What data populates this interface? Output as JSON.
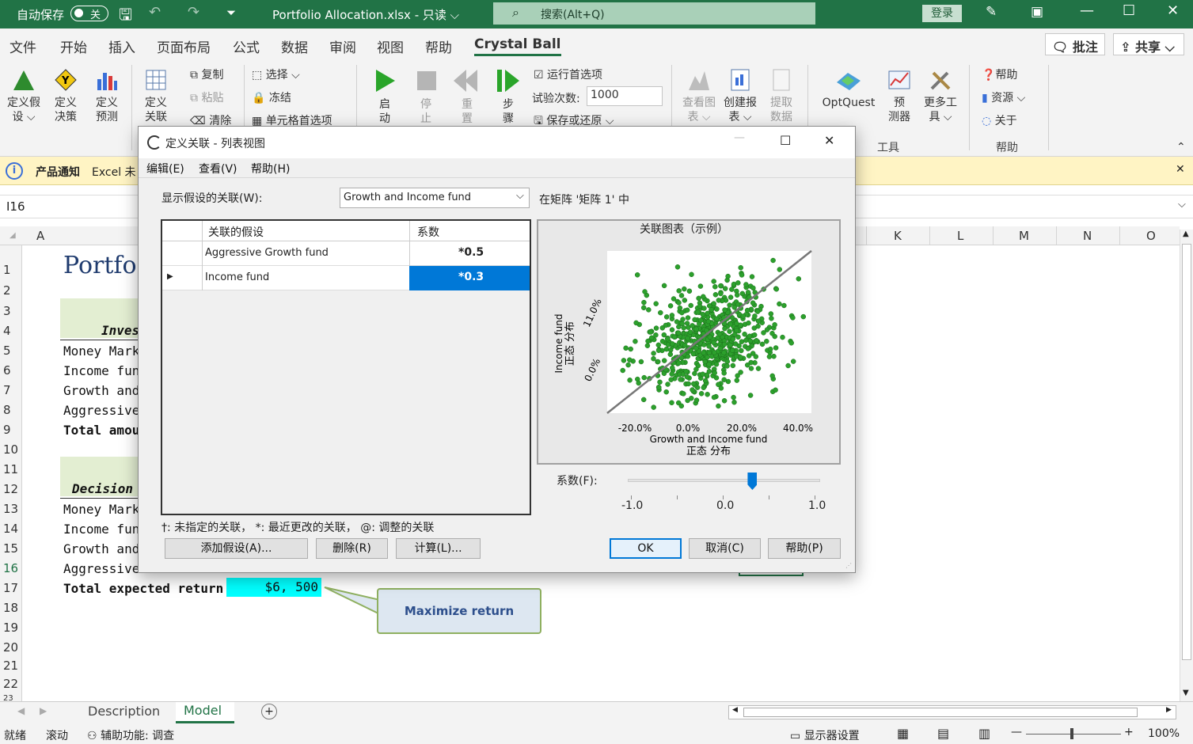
{
  "titlebar": {
    "autosave_label": "自动保存",
    "autosave_state": "关",
    "filename": "Portfolio Allocation.xlsx - 只读 ⌵",
    "search_placeholder": "搜索(Alt+Q)",
    "login": "登录"
  },
  "menu": {
    "tabs": [
      "文件",
      "开始",
      "插入",
      "页面布局",
      "公式",
      "数据",
      "审阅",
      "视图",
      "帮助",
      "Crystal Ball"
    ],
    "comments": "批注",
    "share": "共享"
  },
  "ribbon": {
    "define_assumption": "定义假\n设 ⌵",
    "define_decision": "定义\n决策",
    "define_forecast": "定义\n预测",
    "define_correlation": "定义\n关联",
    "copy": "复制",
    "paste": "粘贴",
    "clear": "清除",
    "select": "选择 ⌵",
    "freeze": "冻结",
    "cell_prefs": "单元格首选项",
    "start": "启\n动",
    "stop": "停\n止",
    "reset": "重\n置",
    "step": "步\n骤",
    "run_prefs": "运行首选项",
    "trials_label": "试验次数:",
    "trials_value": "1000",
    "save_restore": "保存或还原 ⌵",
    "view_charts": "查看图\n表 ⌵",
    "create_report": "创建报\n表 ⌵",
    "extract_data": "提取\n数据",
    "optquest": "OptQuest",
    "predictor": "预\n测器",
    "more_tools": "更多工\n具 ⌵",
    "tools_group": "工具",
    "help": "帮助",
    "resources": "资源 ⌵",
    "about": "关于",
    "help_group": "帮助"
  },
  "notice": {
    "title": "产品通知",
    "text": "Excel 未"
  },
  "formula": {
    "name_box": "I16"
  },
  "grid": {
    "columns_left": [
      "A"
    ],
    "columns_right": [
      "K",
      "L",
      "M",
      "N",
      "O"
    ],
    "rows": [
      "1",
      "2",
      "3",
      "4",
      "5",
      "6",
      "7",
      "8",
      "9",
      "10",
      "11",
      "12",
      "13",
      "14",
      "15",
      "16",
      "17",
      "18",
      "19",
      "20",
      "21",
      "22",
      "23"
    ],
    "cells": {
      "r1": "Portfo",
      "r4": "Inves",
      "r5": "Money Marke",
      "r6": "Income fund",
      "r7": "Growth and",
      "r8": "Aggressive",
      "r9": "Total amou",
      "r12": "Decision",
      "r13": "Money Marke",
      "r14": "Income fund",
      "r15": "Growth and",
      "r16": "Aggressive",
      "r17": "Total expected return",
      "r17_value": "$6, 500"
    },
    "callout": "Maximize return"
  },
  "dialog": {
    "title": "定义关联 - 列表视图",
    "menu": [
      "编辑(E)",
      "查看(V)",
      "帮助(H)"
    ],
    "show_label": "显示假设的关联(W):",
    "selected_assumption": "Growth and Income fund",
    "matrix_label": "在矩阵 '矩阵 1' 中",
    "table_headers": [
      "关联的假设",
      "系数"
    ],
    "rows": [
      {
        "name": "Aggressive Growth fund",
        "coef": "*0.5"
      },
      {
        "name": "Income fund",
        "coef": "*0.3"
      }
    ],
    "legend": "†: 未指定的关联， *: 最近更改的关联， @: 调整的关联",
    "chart_title": "关联图表（示例）",
    "y_axis_label_1": "Income fund",
    "y_axis_label_2": "正态 分布",
    "y_ticks": [
      "11.0%",
      "0.0%"
    ],
    "x_ticks": [
      "-20.0%",
      "0.0%",
      "20.0%",
      "40.0%"
    ],
    "x_axis_label_1": "Growth and Income fund",
    "x_axis_label_2": "正态 分布",
    "coef_label": "系数(F):",
    "slider_ticks": [
      "-1.0",
      "0.0",
      "1.0"
    ],
    "slider_value": 0.3,
    "buttons": {
      "add": "添加假设(A)...",
      "delete": "删除(R)",
      "compute": "计算(L)...",
      "ok": "OK",
      "cancel": "取消(C)",
      "help": "帮助(P)"
    }
  },
  "sheets": [
    "Description",
    "Model"
  ],
  "status": {
    "ready": "就绪",
    "scroll": "滚动",
    "accessibility": "辅助功能: 调查",
    "display_settings": "显示器设置",
    "zoom": "100%"
  },
  "colors": {
    "excel_green": "#217346",
    "highlight_cyan": "#00ffff",
    "selection_blue": "#0078d7",
    "scatter_green": "#2ca02c"
  }
}
